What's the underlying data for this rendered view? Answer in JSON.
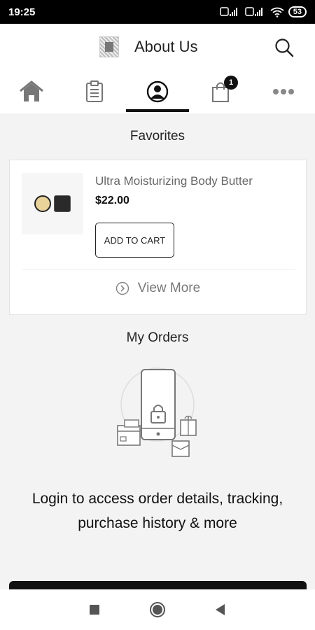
{
  "status_bar": {
    "time": "19:25",
    "battery": "53"
  },
  "header": {
    "title": "About Us"
  },
  "tabs": [
    {
      "name": "home-icon"
    },
    {
      "name": "clipboard-icon"
    },
    {
      "name": "user-icon"
    },
    {
      "name": "bag-icon",
      "badge": "1"
    },
    {
      "name": "more-icon"
    }
  ],
  "favorites": {
    "title": "Favorites",
    "product": {
      "name": "Ultra Moisturizing Body Butter",
      "price": "$22.00"
    },
    "add_to_cart_label": "ADD TO CART",
    "view_more_label": "View More"
  },
  "orders": {
    "title": "My Orders",
    "login_line1": "Login to access order details, tracking,",
    "login_line2": "purchase history & more"
  },
  "colors": {
    "accent": "#111111",
    "background": "#f3f3f3"
  }
}
